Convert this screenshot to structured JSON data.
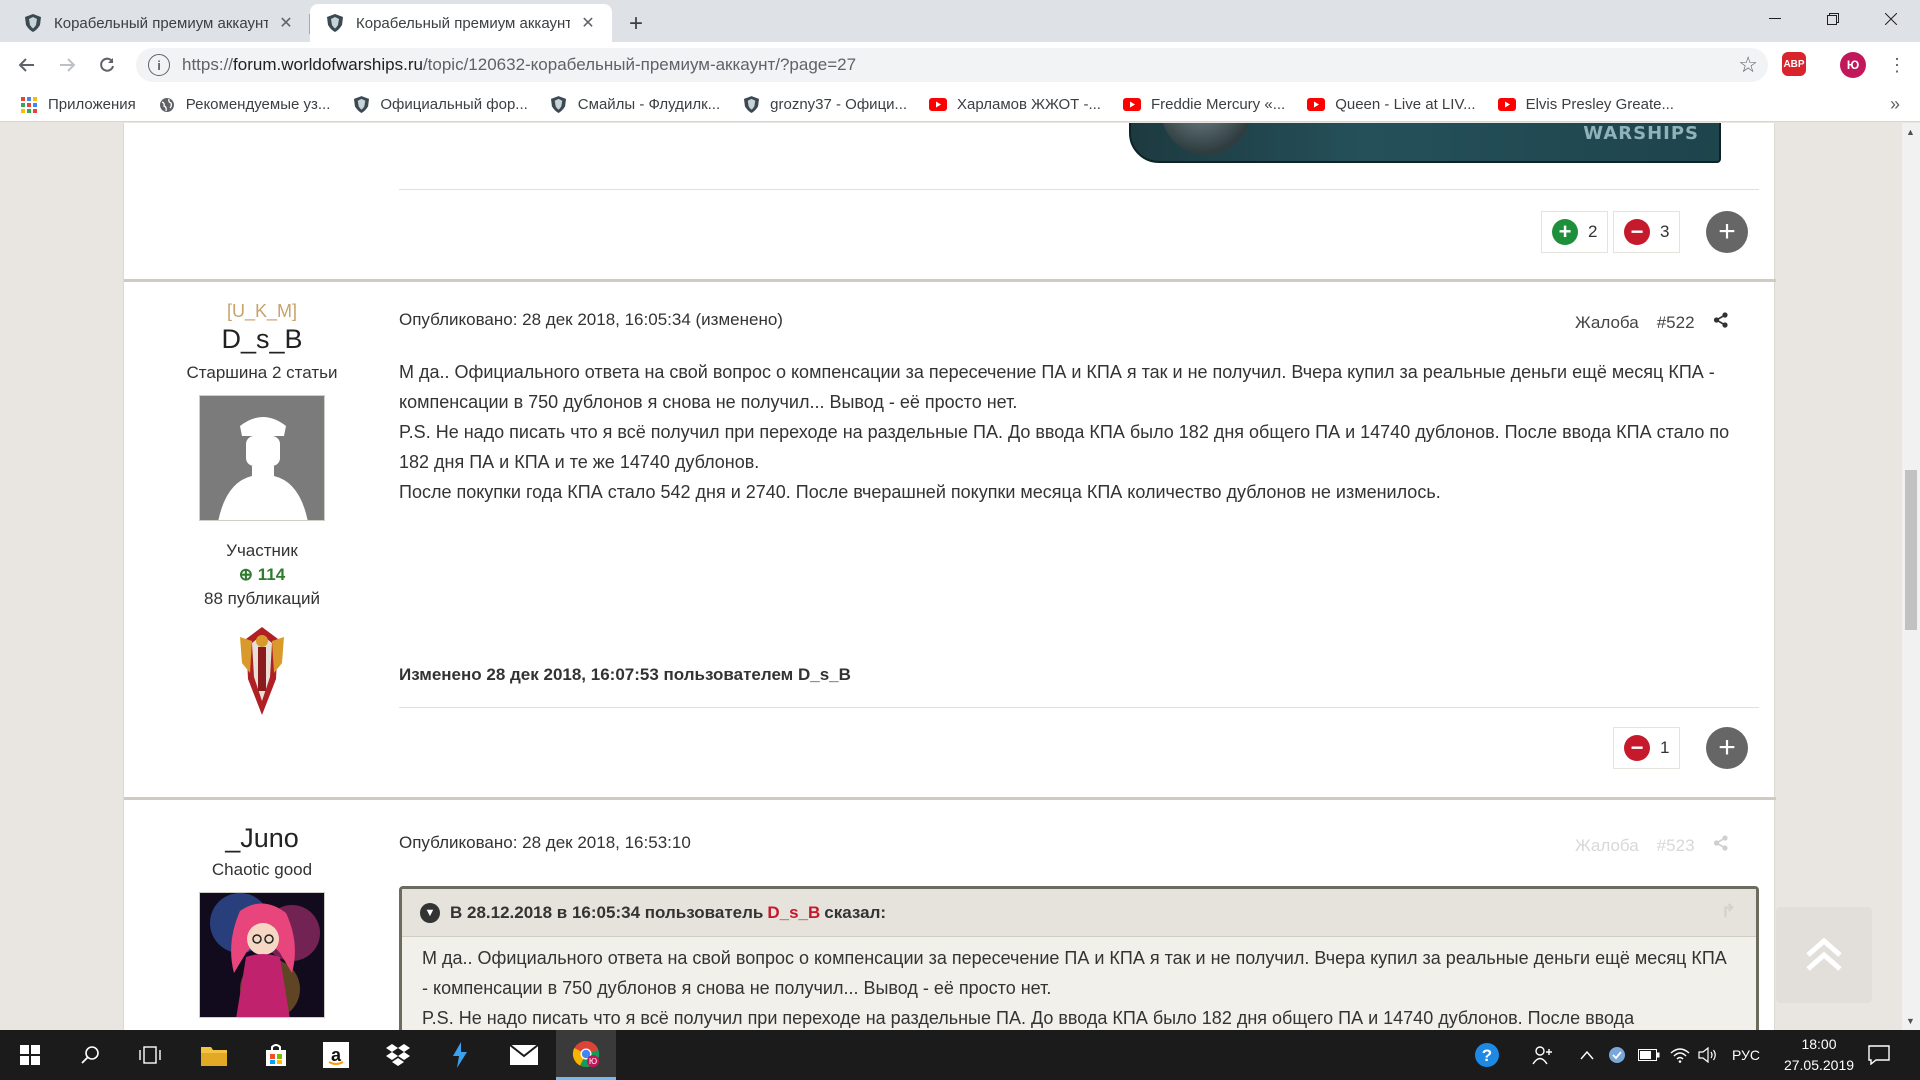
{
  "browser": {
    "tabs": [
      {
        "title": "Корабельный премиум аккаунт"
      },
      {
        "title": "Корабельный премиум аккаунт"
      }
    ],
    "url_prefix": "https://",
    "url_host": "forum.worldofwarships.ru",
    "url_path": "/topic/120632-корабельный-премиум-аккаунт/?page=27",
    "extensions": {
      "adblock": "ABP",
      "profile": "Ю"
    },
    "bookmarks": [
      {
        "label": "Приложения",
        "icon": "apps-grid-icon"
      },
      {
        "label": "Рекомендуемые уз...",
        "icon": "globe-icon"
      },
      {
        "label": "Официальный фор...",
        "icon": "wows-shield-icon"
      },
      {
        "label": "Смайлы - Флудилк...",
        "icon": "wows-shield-icon"
      },
      {
        "label": "grozny37 - Офици...",
        "icon": "wows-shield-icon"
      },
      {
        "label": "Харламов ЖЖОТ -...",
        "icon": "youtube-icon"
      },
      {
        "label": "Freddie Mercury «...",
        "icon": "youtube-icon"
      },
      {
        "label": "Queen - Live at LIV...",
        "icon": "youtube-icon"
      },
      {
        "label": "Elvis Presley Greate...",
        "icon": "youtube-icon"
      }
    ]
  },
  "forum": {
    "banner_logo": "WARSHIPS",
    "prev_post": {
      "rep_plus": "2",
      "rep_minus": "3"
    },
    "post_522": {
      "clan": "[U_K_M]",
      "author": "D_s_B",
      "title": "Старшина 2 статьи",
      "role": "Участник",
      "reputation": "114",
      "posts": "88 публикаций",
      "meta": "Опубликовано: 28 дек 2018, 16:05:34 (изменено)",
      "report": "Жалоба",
      "number": "#522",
      "body": [
        "М да.. Официального ответа на свой вопрос о компенсации за пересечение ПА и КПА я так и не  получил. Вчера купил за реальные деньги ещё месяц КПА - компенсации в 750 дублонов я снова не получил... Вывод - её просто нет.",
        "P.S. Не надо писать что я всё получил при переходе на раздельные ПА. До ввода КПА было 182 дня общего ПА и 14740 дублонов. После ввода КПА стало по 182 дня ПА и КПА и те же 14740 дублонов.",
        "После покупки года КПА стало 542 дня и 2740. После вчерашней покупки месяца КПА количество дублонов не изменилось."
      ],
      "edited": "Изменено 28 дек 2018, 16:07:53 пользователем D_s_B",
      "rep_minus": "1"
    },
    "post_523": {
      "author": "_Juno",
      "title": "Chaotic good",
      "meta": "Опубликовано: 28 дек 2018, 16:53:10",
      "report": "Жалоба",
      "number": "#523",
      "quote_prefix": "В 28.12.2018 в 16:05:34 пользователь",
      "quote_user": "D_s_B",
      "quote_suffix": "сказал:",
      "quote_body": [
        "М да.. Официального ответа на свой вопрос о компенсации за пересечение ПА и КПА я так и не  получил. Вчера купил за реальные деньги ещё месяц КПА - компенсации в 750 дублонов я снова не получил... Вывод - её просто нет.",
        "P.S. Не надо писать что я всё получил при переходе на раздельные ПА. До ввода КПА было 182 дня общего ПА и 14740 дублонов. После ввода"
      ]
    }
  },
  "taskbar": {
    "lang": "РУС",
    "time": "18:00",
    "date": "27.05.2019",
    "chrome_badge": "Ю"
  }
}
